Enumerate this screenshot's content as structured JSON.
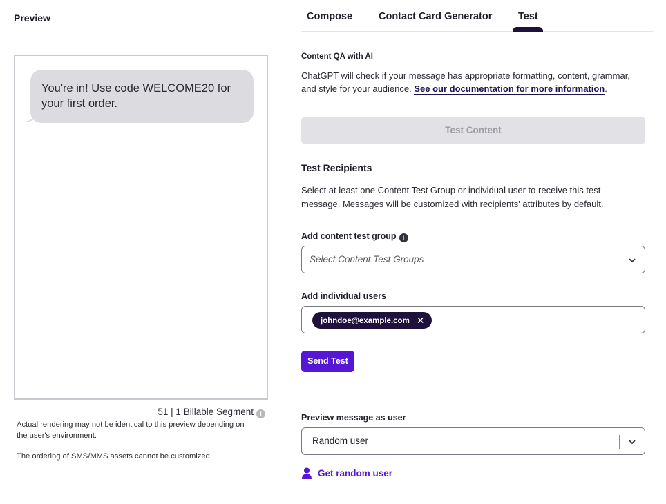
{
  "preview": {
    "heading": "Preview",
    "message": "You're in! Use code WELCOME20 for your first order.",
    "segment_info": "51 | 1 Billable Segment",
    "note_rendering": "Actual rendering may not be identical to this preview depending on the user's environment.",
    "note_ordering": "The ordering of SMS/MMS assets cannot be customized."
  },
  "tabs": [
    {
      "label": "Compose"
    },
    {
      "label": "Contact Card Generator"
    },
    {
      "label": "Test",
      "active": true
    }
  ],
  "qa": {
    "title": "Content QA with AI",
    "description": "ChatGPT will check if your message has appropriate formatting, content, grammar, and style for your audience.",
    "doc_link": "See our documentation for more information",
    "period": ".",
    "button": "Test Content"
  },
  "recipients": {
    "title": "Test Recipients",
    "description": "Select at least one Content Test Group or individual user to receive this test message. Messages will be customized with recipients' attributes by default.",
    "group_label": "Add content test group",
    "group_placeholder": "Select Content Test Groups",
    "users_label": "Add individual users",
    "user_tag": "johndoe@example.com",
    "send_button": "Send Test"
  },
  "preview_as": {
    "label": "Preview message as user",
    "selected": "Random user",
    "random_link": "Get random user"
  },
  "colors": {
    "accent": "#5616d5",
    "dark": "#1e123d",
    "bubble": "#dcdce0"
  }
}
